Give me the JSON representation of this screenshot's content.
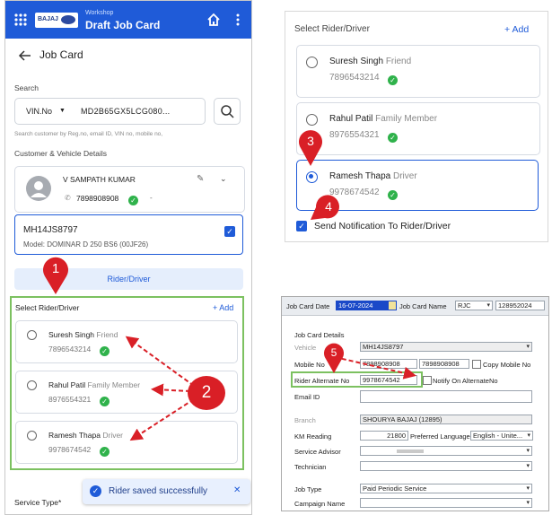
{
  "phone": {
    "app_subtitle": "Workshop",
    "app_title": "Draft Job Card",
    "logo_text": "BAJAJ",
    "page_title": "Job Card",
    "search_label": "Search",
    "search_type": "VIN.No",
    "search_value": "MD2B65GX5LCG080...",
    "search_hint": "Search customer by Reg.no, email ID, VIN no, mobile no,",
    "section_customer": "Customer & Vehicle Details",
    "customer_name": "V SAMPATH KUMAR",
    "customer_phone": "7898908908",
    "customer_extra": "-",
    "vehicle_reg": "MH14JS8797",
    "vehicle_model": "Model: DOMINAR D 250 BS6 (00JF26)",
    "tab_rider": "Rider/Driver",
    "select_rider_label": "Select Rider/Driver",
    "add_label": "+ Add",
    "riders": [
      {
        "name": "Suresh Singh",
        "relation": "Friend",
        "phone": "7896543214"
      },
      {
        "name": "Rahul Patil",
        "relation": "Family Member",
        "phone": "8976554321"
      },
      {
        "name": "Ramesh Thapa",
        "relation": "Driver",
        "phone": "9978674542"
      }
    ],
    "service_type_label": "Service Type*",
    "toast": "Rider saved successfully",
    "toast_close": "✕"
  },
  "rider_panel": {
    "select_label": "Select Rider/Driver",
    "add_label": "+ Add",
    "riders": [
      {
        "name": "Suresh Singh",
        "relation": "Friend",
        "phone": "7896543214"
      },
      {
        "name": "Rahul Patil",
        "relation": "Family Member",
        "phone": "8976554321"
      },
      {
        "name": "Ramesh Thapa",
        "relation": "Driver",
        "phone": "9978674542"
      }
    ],
    "notify_label": "Send Notification To Rider/Driver"
  },
  "win": {
    "job_card_date_label": "Job Card Date",
    "job_card_date": "16-07-2024",
    "job_card_name_label": "Job Card Name",
    "job_card_name": "RJC",
    "job_card_no": "128952024",
    "details_label": "Job Card Details",
    "vehicle_label": "Vehicle",
    "vehicle_value": "MH14JS8797",
    "mobile_label": "Mobile No",
    "mobile_1": "7898908908",
    "mobile_2": "7898908908",
    "copy_mobile_label": "Copy Mobile No",
    "rider_alt_label": "Rider Alternate No",
    "rider_alt_value": "9978674542",
    "notify_alt_label": "Notify On AlternateNo",
    "email_label": "Email ID",
    "branch_label": "Branch",
    "branch_value": "SHOURYA BAJAJ (12895)",
    "km_label": "KM Reading",
    "km_value": "21800",
    "pref_lang_label": "Preferred Language",
    "pref_lang_value": "English - Unite...",
    "advisor_label": "Service Advisor",
    "technician_label": "Technician",
    "job_type_label": "Job Type",
    "job_type_value": "Paid Periodic Service",
    "campaign_label": "Campaign Name"
  },
  "markers": [
    "1",
    "2",
    "3",
    "4",
    "5"
  ],
  "colors": {
    "primary": "#1f5bd8",
    "highlight_green": "#7cc160",
    "marker_red": "#d91f26",
    "verified": "#2fb24b"
  }
}
